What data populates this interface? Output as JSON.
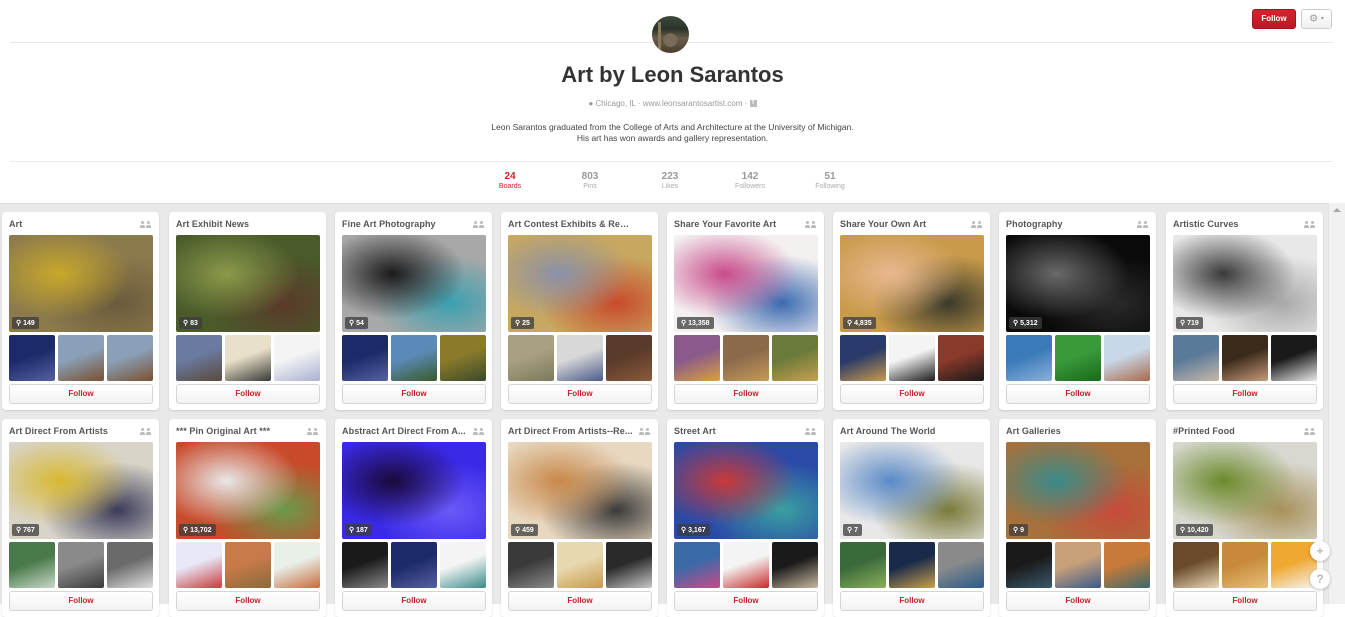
{
  "profile": {
    "name": "Art by Leon Sarantos",
    "location": "Chicago, IL",
    "website": "www.leonsarantosartist.com",
    "separator": "·",
    "bio_line1": "Leon Sarantos graduated from the College of Arts and Architecture at the University of Michigan.",
    "bio_line2": "His art has won awards and gallery representation.",
    "location_icon": "location-pin-icon",
    "social_icon": "facebook-icon"
  },
  "actions": {
    "follow_label": "Follow",
    "settings_icon": "gear-icon",
    "settings_caret": "▾"
  },
  "stats": [
    {
      "value": "24",
      "label": "Boards",
      "active": true
    },
    {
      "value": "803",
      "label": "Pins",
      "active": false
    },
    {
      "value": "223",
      "label": "Likes",
      "active": false
    },
    {
      "value": "142",
      "label": "Followers",
      "active": false
    },
    {
      "value": "51",
      "label": "Following",
      "active": false
    }
  ],
  "colors": {
    "brand_red": "#c8232c",
    "grid_background": "#e9e9e9"
  },
  "boards": [
    {
      "name": "Art",
      "pins": "149",
      "group": true,
      "follow": "Follow",
      "cover": [
        "#8b7a4c",
        "#c9a82a",
        "#6b5a3c"
      ],
      "thumbs": [
        [
          "#1c2a6a",
          "#5560a0"
        ],
        [
          "#8aa0b8",
          "#7a5030"
        ],
        [
          "#8aa0b8",
          "#7a5030"
        ]
      ]
    },
    {
      "name": "Art Exhibit News",
      "pins": "83",
      "group": false,
      "follow": "Follow",
      "cover": [
        "#4a5a2a",
        "#8a9a4a",
        "#5a3a2a"
      ],
      "thumbs": [
        [
          "#6a7aa0",
          "#5a4a3a"
        ],
        [
          "#e8e0c8",
          "#3a3a3a"
        ],
        [
          "#f4f4f4",
          "#aab0d0"
        ]
      ]
    },
    {
      "name": "Fine Art Photography",
      "pins": "54",
      "group": true,
      "follow": "Follow",
      "cover": [
        "#a8a8a8",
        "#1a1a1a",
        "#3aa0b0"
      ],
      "thumbs": [
        [
          "#1c2a6a",
          "#5560a0"
        ],
        [
          "#5a8ab8",
          "#3a5a2a"
        ],
        [
          "#8a7a2a",
          "#3a4a2a"
        ]
      ]
    },
    {
      "name": "Art Contest Exhibits & Reco...",
      "pins": "25",
      "group": false,
      "follow": "Follow",
      "cover": [
        "#c8a860",
        "#8a90a8",
        "#c84a2a"
      ],
      "thumbs": [
        [
          "#a8a080",
          "#7a7a5a"
        ],
        [
          "#d8d8d8",
          "#4a5a8a"
        ],
        [
          "#5a3a2a",
          "#8a5a3a"
        ]
      ]
    },
    {
      "name": "Share Your Favorite Art",
      "pins": "13,358",
      "group": true,
      "follow": "Follow",
      "cover": [
        "#f4f0f0",
        "#c84a8a",
        "#3a6ab0"
      ],
      "thumbs": [
        [
          "#8a5a8a",
          "#d8a040"
        ],
        [
          "#8a6a4a",
          "#c89a5a"
        ],
        [
          "#6a7a3a",
          "#c8a050"
        ]
      ]
    },
    {
      "name": "Share Your Own Art",
      "pins": "4,835",
      "group": true,
      "follow": "Follow",
      "cover": [
        "#c89a4a",
        "#e8b890",
        "#3a3a2a"
      ],
      "thumbs": [
        [
          "#2a3a6a",
          "#c89a4a"
        ],
        [
          "#f4f4f4",
          "#1a1a1a"
        ],
        [
          "#8a3a2a",
          "#1a1a1a"
        ]
      ]
    },
    {
      "name": "Photography",
      "pins": "5,312",
      "group": true,
      "follow": "Follow",
      "cover": [
        "#0a0a0a",
        "#6a6a6a",
        "#2a2a2a"
      ],
      "thumbs": [
        [
          "#3a7ab8",
          "#8ab0d8"
        ],
        [
          "#3a9a3a",
          "#1a6a1a"
        ],
        [
          "#c8d8e8",
          "#a86a4a"
        ]
      ]
    },
    {
      "name": "Artistic Curves",
      "pins": "719",
      "group": true,
      "follow": "Follow",
      "cover": [
        "#e8e8e8",
        "#3a3a3a",
        "#a8a8a8"
      ],
      "thumbs": [
        [
          "#5a7a9a",
          "#c8b8a8"
        ],
        [
          "#3a2a1a",
          "#c89a7a"
        ],
        [
          "#1a1a1a",
          "#e8e8e8"
        ]
      ]
    },
    {
      "name": "Art Direct From Artists",
      "pins": "767",
      "group": true,
      "follow": "Follow",
      "cover": [
        "#d8d4c8",
        "#d8b830",
        "#3a3a5a"
      ],
      "thumbs": [
        [
          "#4a7a4a",
          "#c8d8c8"
        ],
        [
          "#8a8a8a",
          "#3a3a3a"
        ],
        [
          "#6a6a6a",
          "#e0e0e0"
        ]
      ]
    },
    {
      "name": "*** Pin Original Art ***",
      "pins": "13,702",
      "group": true,
      "follow": "Follow",
      "cover": [
        "#c84a2a",
        "#e8e8e8",
        "#6a9a4a"
      ],
      "thumbs": [
        [
          "#e8e8f8",
          "#c83a3a"
        ],
        [
          "#c87a4a",
          "#8a6a3a"
        ],
        [
          "#e8f0e8",
          "#c86a3a"
        ]
      ]
    },
    {
      "name": "Abstract Art Direct From A...",
      "pins": "187",
      "group": true,
      "follow": "Follow",
      "cover": [
        "#3a2ae8",
        "#1a0a3a",
        "#6a5af8"
      ],
      "thumbs": [
        [
          "#1a1a1a",
          "#8a8a8a"
        ],
        [
          "#1c2a6a",
          "#5560a0"
        ],
        [
          "#f4f4f4",
          "#3a8a8a"
        ]
      ]
    },
    {
      "name": "Art Direct From Artists--Re...",
      "pins": "459",
      "group": true,
      "follow": "Follow",
      "cover": [
        "#e8d8c0",
        "#c8884a",
        "#3a3a3a"
      ],
      "thumbs": [
        [
          "#3a3a3a",
          "#8a8a8a"
        ],
        [
          "#e8d8b0",
          "#c89a4a"
        ],
        [
          "#2a2a2a",
          "#c8c8c8"
        ]
      ]
    },
    {
      "name": "Street Art",
      "pins": "3,167",
      "group": true,
      "follow": "Follow",
      "cover": [
        "#2a4aa8",
        "#c83a3a",
        "#3aa0a0"
      ],
      "thumbs": [
        [
          "#3a6aa8",
          "#c84a8a"
        ],
        [
          "#f4f4f4",
          "#c82a2a"
        ],
        [
          "#1a1a1a",
          "#c8b8a0"
        ]
      ]
    },
    {
      "name": "Art Around The World",
      "pins": "7",
      "group": false,
      "follow": "Follow",
      "cover": [
        "#e8e8e8",
        "#5a8ac8",
        "#7a7a3a"
      ],
      "thumbs": [
        [
          "#3a6a3a",
          "#8ab05a"
        ],
        [
          "#1a2a4a",
          "#c8a04a"
        ],
        [
          "#8a8a8a",
          "#2a5a8a"
        ]
      ]
    },
    {
      "name": "Art Galleries",
      "pins": "9",
      "group": false,
      "follow": "Follow",
      "cover": [
        "#a8703a",
        "#3a8a8a",
        "#c84a3a"
      ],
      "thumbs": [
        [
          "#1a1a1a",
          "#3a5a6a"
        ],
        [
          "#c8a07a",
          "#3a5a8a"
        ],
        [
          "#c87a3a",
          "#3a6a6a"
        ]
      ]
    },
    {
      "name": "#Printed Food",
      "pins": "10,420",
      "group": true,
      "follow": "Follow",
      "cover": [
        "#d8d8d0",
        "#6a8a2a",
        "#a8905a"
      ],
      "thumbs": [
        [
          "#6a4a2a",
          "#e8d8b8"
        ],
        [
          "#c88a3a",
          "#e8c07a"
        ],
        [
          "#f0a830",
          "#f4f4f4"
        ]
      ]
    }
  ],
  "floating": {
    "add_label": "+",
    "help_label": "?"
  }
}
